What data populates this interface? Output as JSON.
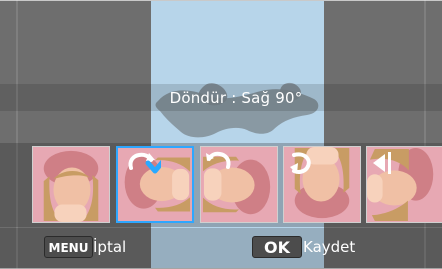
{
  "status": {
    "text": "Döndür : Sağ 90°"
  },
  "thumbnails": [
    {
      "name": "thumbnail-original",
      "selected": false,
      "rotation": 0
    },
    {
      "name": "thumbnail-rotate-right",
      "selected": true,
      "rotation": 90,
      "icon": "rotate-right-check-icon"
    },
    {
      "name": "thumbnail-rotate-left",
      "selected": false,
      "rotation": 270,
      "icon": "rotate-left-icon"
    },
    {
      "name": "thumbnail-rotate-180",
      "selected": false,
      "rotation": 180,
      "icon": "rotate-180-icon"
    },
    {
      "name": "thumbnail-flip",
      "selected": false,
      "rotation": 0,
      "icon": "flip-icon"
    }
  ],
  "footer": {
    "menu_key": "MENU",
    "cancel_label": "İptal",
    "ok_key": "OK",
    "save_label": "Kaydet"
  }
}
